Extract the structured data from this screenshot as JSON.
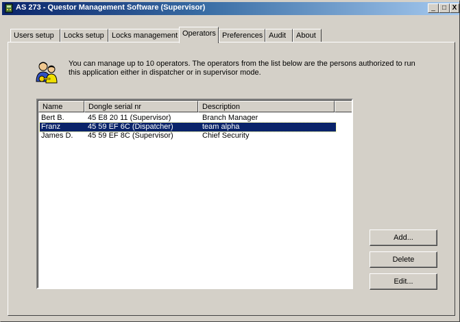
{
  "window": {
    "title": "AS 273 - Questor Management Software (Supervisor)",
    "controls": {
      "minimize": "_",
      "maximize": "□",
      "close": "X"
    }
  },
  "tabs": [
    {
      "label": "Users setup",
      "active": false
    },
    {
      "label": "Locks setup",
      "active": false
    },
    {
      "label": "Locks management",
      "active": false
    },
    {
      "label": "Operators",
      "active": true
    },
    {
      "label": "Preferences",
      "active": false
    },
    {
      "label": "Audit",
      "active": false
    },
    {
      "label": "About",
      "active": false
    }
  ],
  "operators": {
    "info_icon": "operators-people-key-icon",
    "info_text": "You can manage up to 10 operators. The operators from the list below are the persons authorized to run this application either in dispatcher or in supervisor mode.",
    "columns": [
      "Name",
      "Dongle serial nr",
      "Description"
    ],
    "rows": [
      {
        "name": "Bert B.",
        "dongle": "45 E8 20 11 (Supervisor)",
        "description": "Branch Manager",
        "selected": false
      },
      {
        "name": "Franz",
        "dongle": "45 59 EF 6C (Dispatcher)",
        "description": "team alpha",
        "selected": true
      },
      {
        "name": "James D.",
        "dongle": "45 59 EF 8C (Supervisor)",
        "description": "Chief Security",
        "selected": false
      }
    ],
    "buttons": {
      "add": "Add...",
      "delete": "Delete",
      "edit": "Edit..."
    }
  },
  "colors": {
    "titlebar": "#0a246a",
    "selection": "#0a246a",
    "face": "#d4d0c8"
  }
}
